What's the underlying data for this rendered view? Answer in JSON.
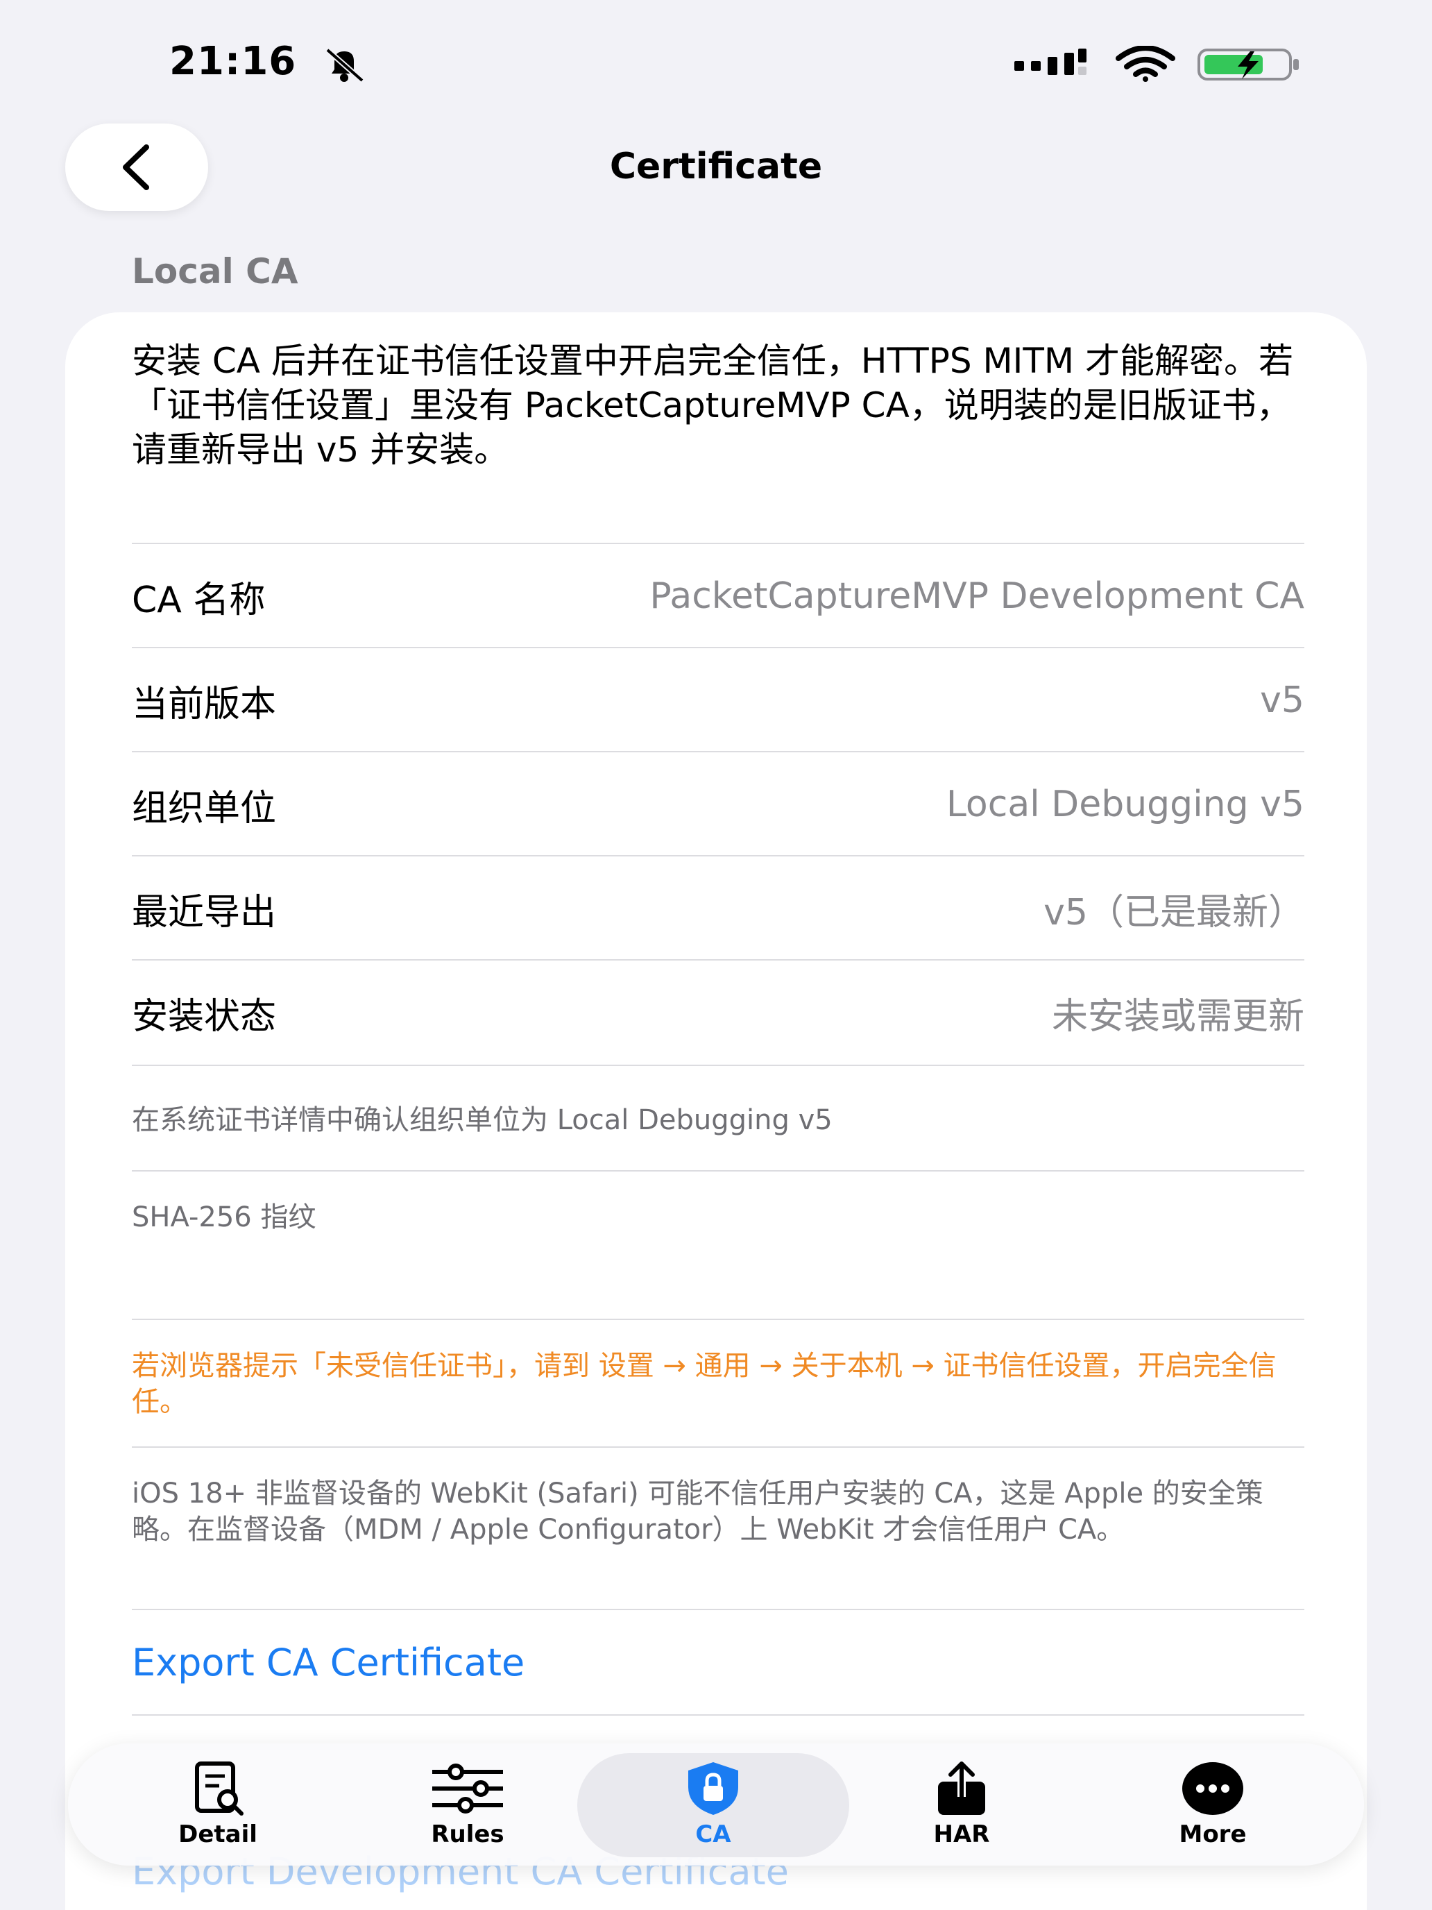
{
  "status_bar": {
    "time": "21:16"
  },
  "nav": {
    "title": "Certificate"
  },
  "section_header": "Local CA",
  "intro": "安装 CA 后并在证书信任设置中开启完全信任，HTTPS MITM 才能解密。若「证书信任设置」里没有 PacketCaptureMVP CA，说明装的是旧版证书，请重新导出 v5 并安装。",
  "rows": [
    {
      "label": "CA 名称",
      "value": "PacketCaptureMVP Development CA"
    },
    {
      "label": "当前版本",
      "value": "v5"
    },
    {
      "label": "组织单位",
      "value": "Local Debugging v5"
    },
    {
      "label": "最近导出",
      "value": "v5（已是最新）"
    },
    {
      "label": "安装状态",
      "value": "未安装或需更新"
    }
  ],
  "confirm_note": "在系统证书详情中确认组织单位为 Local Debugging v5",
  "fingerprint_label": "SHA-256 指纹",
  "warning": "若浏览器提示「未受信任证书」，请到 设置 → 通用 → 关于本机 → 证书信任设置，开启完全信任。",
  "ios_note": "iOS 18+ 非监督设备的 WebKit (Safari) 可能不信任用户安装的 CA，这是 Apple 的安全策略。在监督设备（MDM / Apple Configurator）上 WebKit 才会信任用户 CA。",
  "actions": {
    "export_ca": "Export CA Certificate",
    "export_dev_ca": "Export Development CA Certificate"
  },
  "tabs": [
    {
      "label": "Detail",
      "icon": "detail-search-icon"
    },
    {
      "label": "Rules",
      "icon": "sliders-icon"
    },
    {
      "label": "CA",
      "icon": "shield-lock-icon",
      "active": true
    },
    {
      "label": "HAR",
      "icon": "share-upload-icon"
    },
    {
      "label": "More",
      "icon": "ellipsis-circle-icon"
    }
  ],
  "colors": {
    "accent": "#1a7cf2",
    "warning": "#f08a24",
    "background": "#f2f2f7",
    "battery": "#34c759"
  }
}
